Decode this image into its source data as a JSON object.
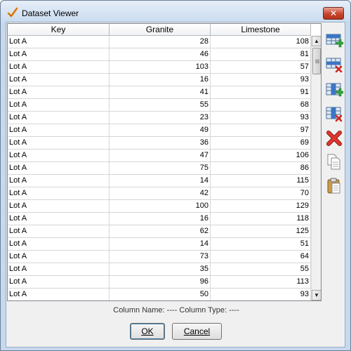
{
  "window": {
    "title": "Dataset Viewer",
    "close_label": "✕"
  },
  "table": {
    "headers": [
      "Key",
      "Granite",
      "Limestone"
    ],
    "rows": [
      [
        "Lot A",
        "28",
        "108"
      ],
      [
        "Lot A",
        "46",
        "81"
      ],
      [
        "Lot A",
        "103",
        "57"
      ],
      [
        "Lot A",
        "16",
        "93"
      ],
      [
        "Lot A",
        "41",
        "91"
      ],
      [
        "Lot A",
        "55",
        "68"
      ],
      [
        "Lot A",
        "23",
        "93"
      ],
      [
        "Lot A",
        "49",
        "97"
      ],
      [
        "Lot A",
        "36",
        "69"
      ],
      [
        "Lot A",
        "47",
        "106"
      ],
      [
        "Lot A",
        "75",
        "86"
      ],
      [
        "Lot A",
        "14",
        "115"
      ],
      [
        "Lot A",
        "42",
        "70"
      ],
      [
        "Lot A",
        "100",
        "129"
      ],
      [
        "Lot A",
        "16",
        "118"
      ],
      [
        "Lot A",
        "62",
        "125"
      ],
      [
        "Lot A",
        "14",
        "51"
      ],
      [
        "Lot A",
        "73",
        "64"
      ],
      [
        "Lot A",
        "35",
        "55"
      ],
      [
        "Lot A",
        "96",
        "113"
      ],
      [
        "Lot A",
        "50",
        "93"
      ]
    ]
  },
  "toolbar": {
    "tools": [
      "add-row-icon",
      "delete-row-icon",
      "add-column-icon",
      "delete-column-icon",
      "delete-all-icon",
      "copy-icon",
      "paste-icon"
    ]
  },
  "column_info": "Column Name: ----   Column Type: ----",
  "buttons": {
    "ok": "OK",
    "cancel": "Cancel"
  }
}
